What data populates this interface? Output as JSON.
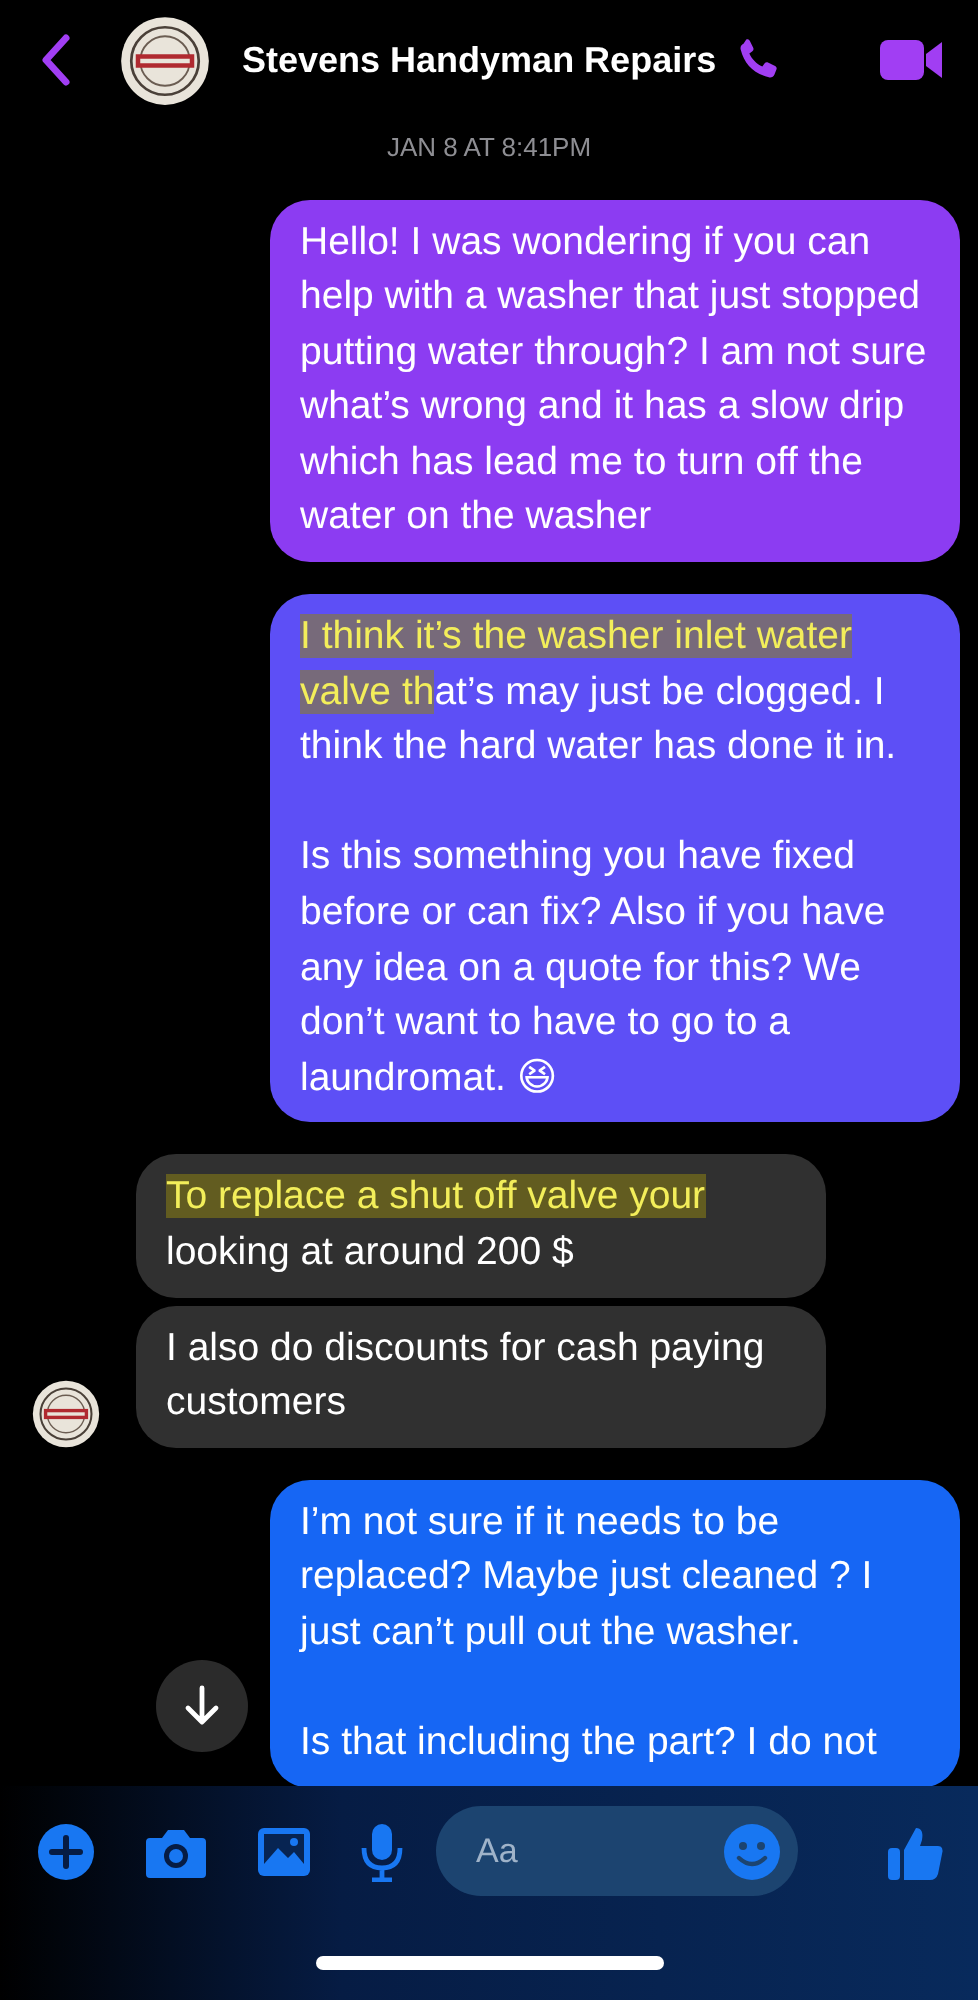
{
  "header": {
    "title": "Stevens Handyman Repairs"
  },
  "timestamp": "JAN 8 AT 8:41PM",
  "messages": [
    {
      "kind": "sent",
      "color": "#8c3cf2",
      "show_avatar": false,
      "paragraphs": [
        [
          {
            "text": "Hello! I was wondering if you can help with a washer that just stopped putting water through? I am not sure what’s wrong and it has a slow drip which has lead me to turn off the water on the washer",
            "highlighted": false
          }
        ]
      ]
    },
    {
      "kind": "sent",
      "color": "#5d4ff6",
      "show_avatar": false,
      "paragraphs": [
        [
          {
            "text": "I think it’s the washer inlet water valve th",
            "highlighted": true
          },
          {
            "text": "at’s may just be clogged. I think the hard water has done it in.",
            "highlighted": false
          }
        ],
        [
          {
            "text": "Is this something you have fixed before or can fix? Also if you have any idea on a quote for this? We don’t want to have to go to a laundromat. 😆",
            "highlighted": false
          }
        ]
      ]
    },
    {
      "kind": "received",
      "color": "#303030",
      "show_avatar": false,
      "paragraphs": [
        [
          {
            "text": "To replace a shut off valve your",
            "highlighted": true
          },
          {
            "text": " looking at around 200 $",
            "highlighted": false
          }
        ]
      ]
    },
    {
      "kind": "received",
      "color": "#303030",
      "show_avatar": true,
      "paragraphs": [
        [
          {
            "text": "I also do discounts for cash paying customers",
            "highlighted": false
          }
        ]
      ]
    },
    {
      "kind": "sent",
      "color": "#1666f4",
      "show_avatar": false,
      "paragraphs": [
        [
          {
            "text": "I’m not sure if it needs to be replaced? Maybe just cleaned ? I just can’t pull out the washer.",
            "highlighted": false
          }
        ],
        [
          {
            "text": "Is that including the part? I do not",
            "highlighted": false
          }
        ]
      ]
    }
  ],
  "composer": {
    "placeholder": "Aa"
  }
}
